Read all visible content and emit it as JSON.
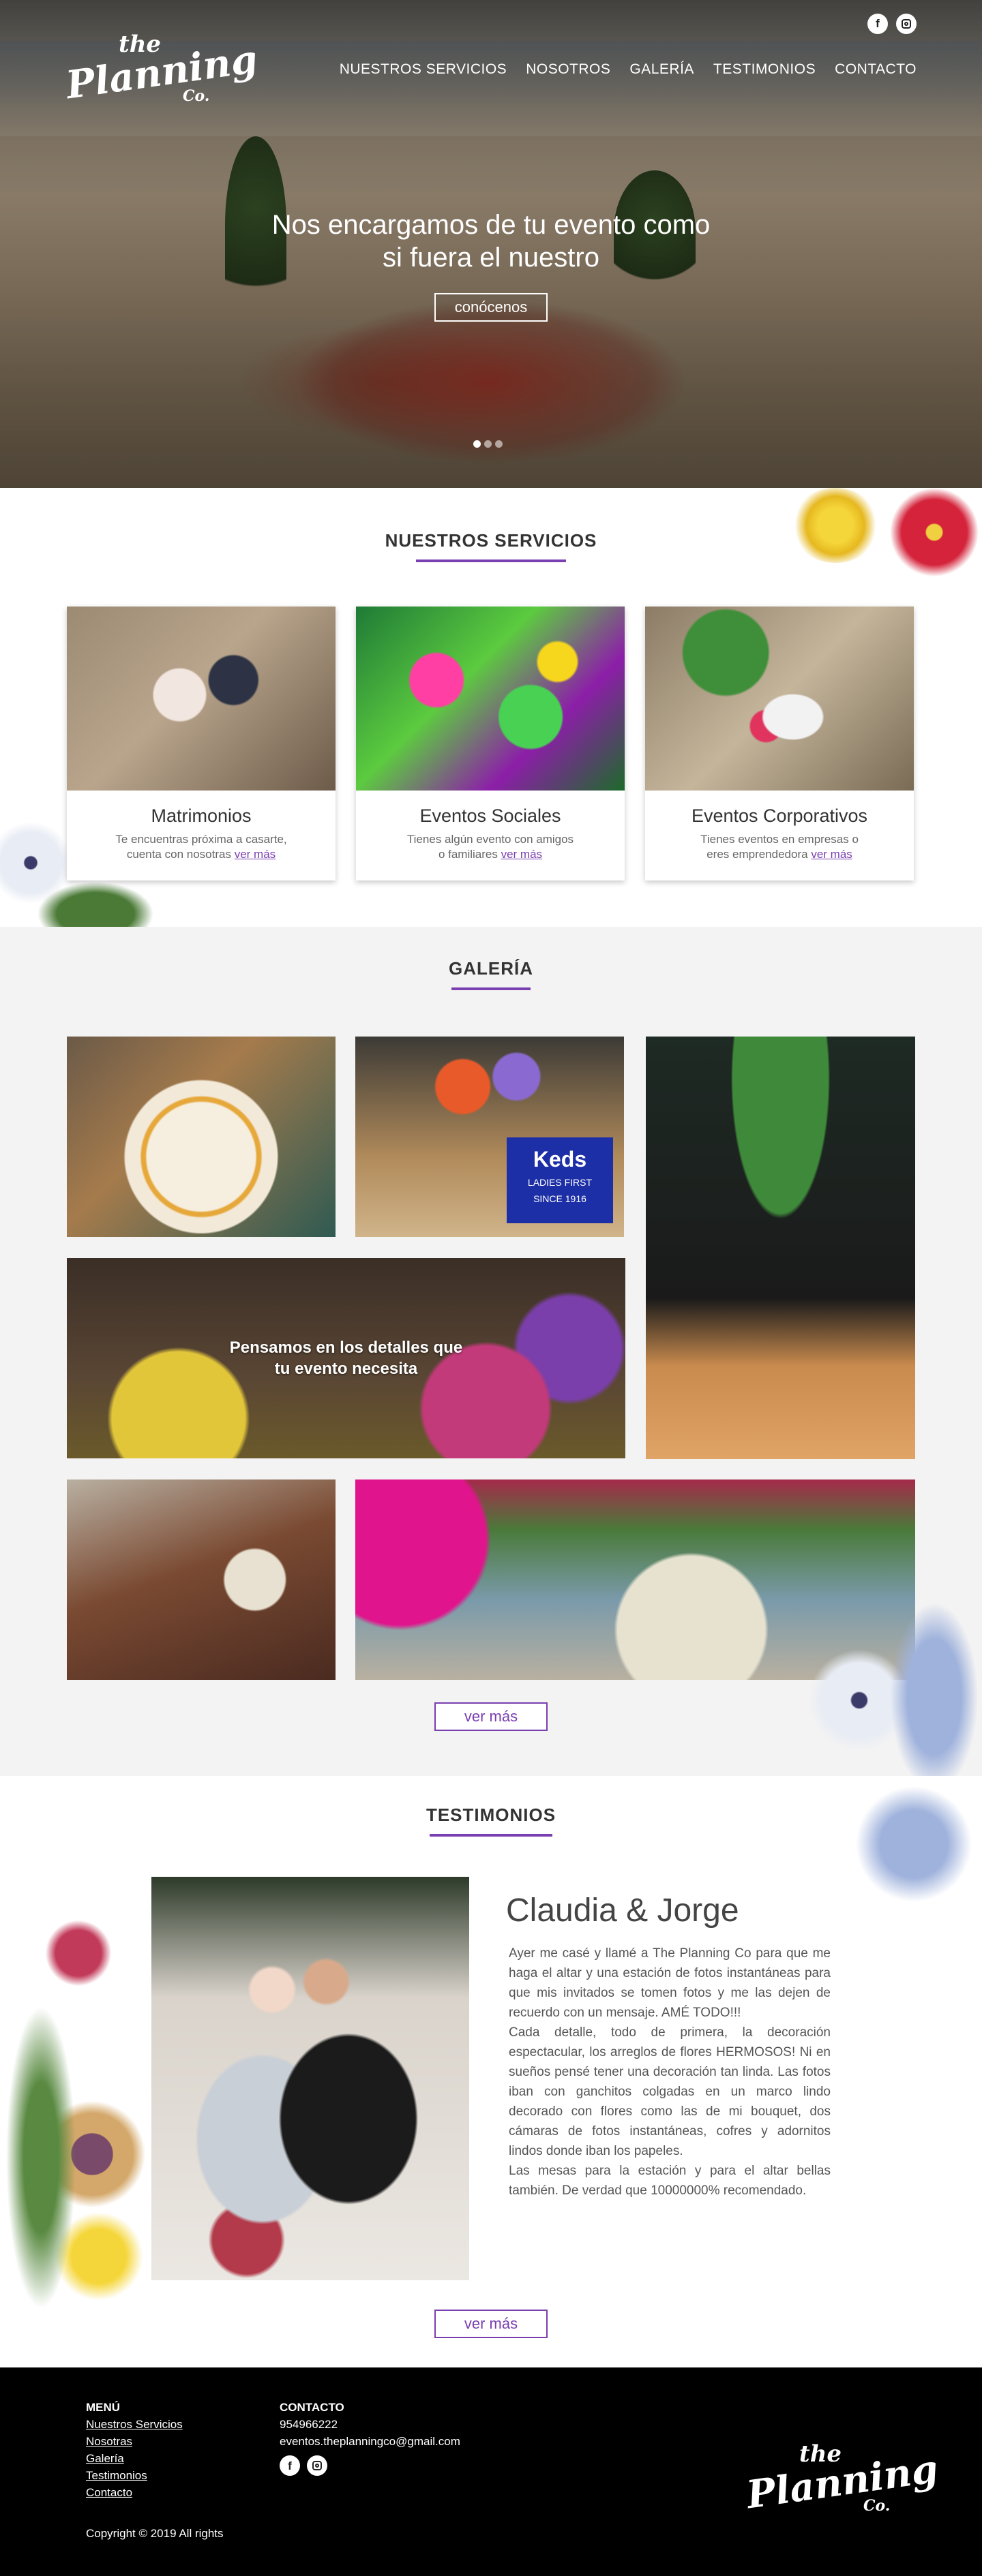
{
  "brand": {
    "logo_line1": "the",
    "logo_line2": "Planning",
    "logo_line3": "Co."
  },
  "social": {
    "facebook_glyph": "f",
    "icons": [
      "facebook-icon",
      "instagram-icon"
    ]
  },
  "nav": {
    "items": [
      {
        "label": "NUESTROS SERVICIOS"
      },
      {
        "label": "NOSOTROS"
      },
      {
        "label": "GALERÍA"
      },
      {
        "label": "TESTIMONIOS"
      },
      {
        "label": "CONTACTO"
      }
    ]
  },
  "hero": {
    "title_line1": "Nos encargamos de tu evento como",
    "title_line2": "si fuera el nuestro",
    "button": "conócenos",
    "slides_count": 3,
    "active_slide": 1
  },
  "services": {
    "title": "NUESTROS SERVICIOS",
    "cards": [
      {
        "title": "Matrimonios",
        "desc_line1": "Te encuentras próxima a casarte,",
        "desc_line2": "cuenta con nosotras",
        "link": "ver más"
      },
      {
        "title": "Eventos Sociales",
        "desc_line1": "Tienes algún evento con amigos",
        "desc_line2": "o familiares",
        "link": "ver más"
      },
      {
        "title": "Eventos Corporativos",
        "desc_line1": "Tienes eventos en empresas o",
        "desc_line2": "eres emprendedora",
        "link": "ver más"
      }
    ]
  },
  "gallery": {
    "title": "GALERÍA",
    "keds_brand": "Keds",
    "keds_line1": "LADIES FIRST",
    "keds_line2": "SINCE 1916",
    "caption_line1": "Pensamos en los detalles que",
    "caption_line2": "tu evento necesita",
    "button": "ver más"
  },
  "testimonials": {
    "title": "TESTIMONIOS",
    "name": "Claudia & Jorge",
    "para1": "Ayer me casé y llamé a The Planning Co para que me haga el altar y una estación de fotos instantáneas para que mis invitados se tomen fotos y me las dejen de recuerdo con un mensaje. AMÉ TODO!!!",
    "para2": "Cada detalle, todo de primera, la decoración espectacular, los arreglos de flores HERMOSOS! Ni en sueños pensé tener una decoración tan linda. Las fotos iban con ganchitos colgadas en un marco lindo decorado con flores como las de mi bouquet, dos cámaras de fotos instantáneas, cofres y adornitos lindos donde iban los papeles.",
    "para3": "Las mesas para la estación y para el altar bellas también. De verdad que 10000000% recomendado.",
    "button": "ver más"
  },
  "footer": {
    "menu_title": "MENÚ",
    "menu_items": [
      "Nuestros Servicios",
      "Nosotras",
      "Galería",
      "Testimonios",
      "Contacto"
    ],
    "contact_title": "CONTACTO",
    "phone": "954966222",
    "email": "eventos.theplanningco@gmail.com",
    "copyright": "Copyright © 2019  All rights"
  },
  "colors": {
    "accent": "#7a3fb0",
    "footer_bg": "#000000",
    "gallery_bg": "#f3f3f3"
  }
}
